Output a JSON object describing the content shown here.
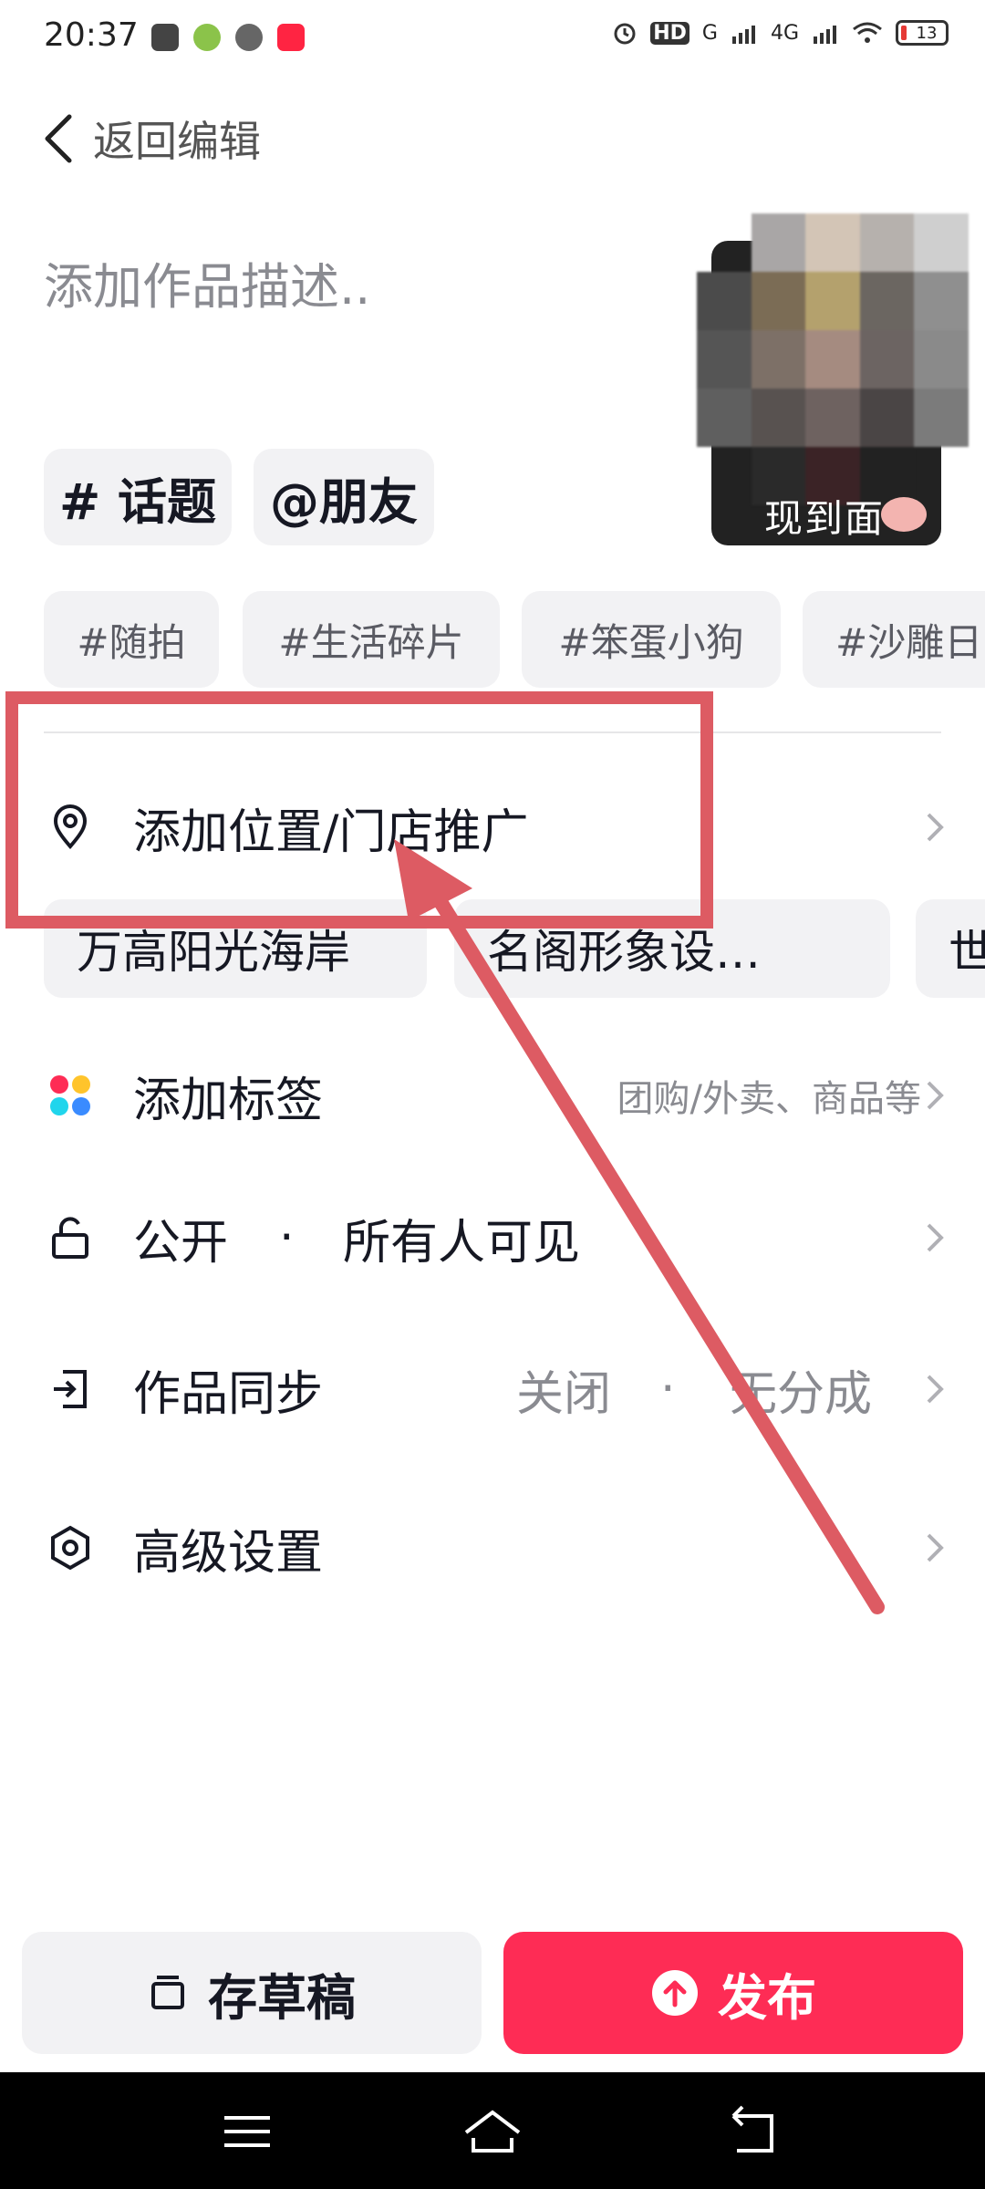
{
  "status_bar": {
    "time": "20:37",
    "hd_label": "HD",
    "signal_1": "G",
    "signal_2": "4G",
    "battery": "13"
  },
  "header": {
    "back_label": "返回编辑"
  },
  "description": {
    "placeholder": "添加作品描述.."
  },
  "thumbnail": {
    "caption": "现到面"
  },
  "chips": {
    "topic": "# 话题",
    "friends": "@朋友"
  },
  "suggested_tags": [
    "#随拍",
    "#生活碎片",
    "#笨蛋小狗",
    "#沙雕日"
  ],
  "location": {
    "label": "添加位置/门店推广",
    "suggestions": [
      "万高阳光海岸",
      "名阁形象设…",
      "世"
    ]
  },
  "add_tag": {
    "label": "添加标签",
    "hint": "团购/外卖、商品等"
  },
  "privacy": {
    "label": "公开",
    "separator": "·",
    "value": "所有人可见"
  },
  "sync": {
    "label": "作品同步",
    "value_1": "关闭",
    "separator": "·",
    "value_2": "无分成"
  },
  "advanced": {
    "label": "高级设置"
  },
  "buttons": {
    "draft": "存草稿",
    "publish": "发布"
  },
  "colors": {
    "accent": "#fe2c55",
    "annotation": "#dd5b63"
  },
  "icons": [
    "back-arrow-icon",
    "location-pin-icon",
    "tag-dots-icon",
    "lock-icon",
    "sync-icon",
    "settings-hex-icon",
    "chevron-right-icon",
    "draft-icon",
    "upload-icon",
    "menu-icon",
    "home-icon",
    "back-icon"
  ]
}
